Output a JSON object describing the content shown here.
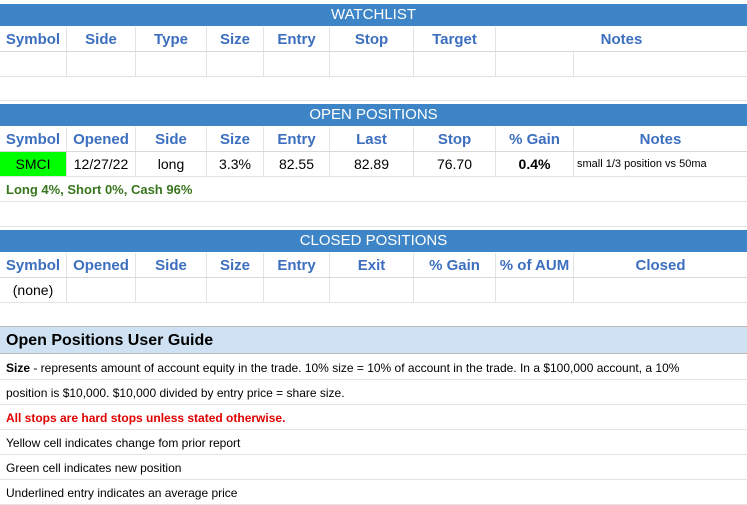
{
  "watchlist": {
    "title": "WATCHLIST",
    "headers": [
      "Symbol",
      "Side",
      "Type",
      "Size",
      "Entry",
      "Stop",
      "Target",
      "Notes"
    ]
  },
  "open_positions": {
    "title": "OPEN POSITIONS",
    "headers": [
      "Symbol",
      "Opened",
      "Side",
      "Size",
      "Entry",
      "Last",
      "Stop",
      "% Gain",
      "Notes"
    ],
    "rows": [
      {
        "symbol": "SMCI",
        "opened": "12/27/22",
        "side": "long",
        "size": "3.3%",
        "entry": "82.55",
        "last": "82.89",
        "stop": "76.70",
        "gain": "0.4%",
        "notes": "small 1/3 position vs 50ma"
      }
    ],
    "summary": "Long 4%, Short 0%, Cash 96%"
  },
  "closed_positions": {
    "title": "CLOSED POSITIONS",
    "headers": [
      "Symbol",
      "Opened",
      "Side",
      "Size",
      "Entry",
      "Exit",
      "% Gain",
      "% of AUM",
      "Closed"
    ],
    "empty_label": "(none)"
  },
  "guide": {
    "title": "Open Positions User Guide",
    "size_term": "Size",
    "size_text_1": " - represents amount of account equity in the trade.  10% size = 10% of account in the trade.  In a $100,000 account, a 10%",
    "size_text_2": "position is $10,000.  $10,000 divided by entry price = share size.",
    "stops_note": "All stops are hard stops unless stated otherwise.",
    "yellow_note": "Yellow cell indicates change fom prior report",
    "green_note": "Green cell indicates new position",
    "underline_note": "Underlined entry indicates an average price"
  },
  "colors": {
    "banner": "#3d85c6",
    "header_text": "#3d6fbf",
    "new_position": "#00ff00",
    "summary_text": "#38761d",
    "guide_title_bg": "#cfe2f3",
    "stops_note_text": "#e00000"
  }
}
